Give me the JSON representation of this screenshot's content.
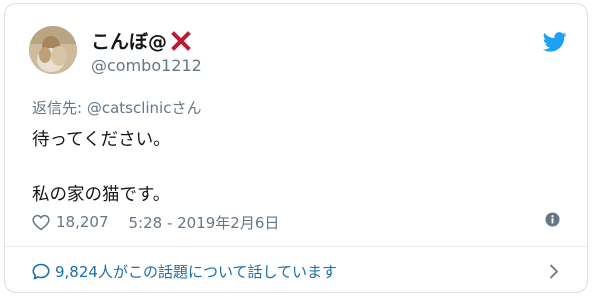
{
  "tweet": {
    "author": {
      "display_name": "こんぼ@",
      "handle": "@combo1212"
    },
    "reply_to": "返信先: @catsclinicさん",
    "text_lines": [
      "待ってください。",
      "私の家の猫です。"
    ],
    "like_count": "18,207",
    "timestamp": "5:28 - 2019年2月6日",
    "conversation_text": "9,824人がこの話題について話しています"
  },
  "icons": {
    "brand": "twitter-bird-icon",
    "like": "heart-icon",
    "info": "info-icon",
    "conversation": "speech-bubble-icon",
    "more": "chevron-right-icon",
    "name_badge": "red-x-icon"
  },
  "colors": {
    "twitter_blue": "#1da1f2",
    "secondary_text": "#657786",
    "link_text": "#1b6fa8",
    "x_mark_red": "#be1931"
  }
}
